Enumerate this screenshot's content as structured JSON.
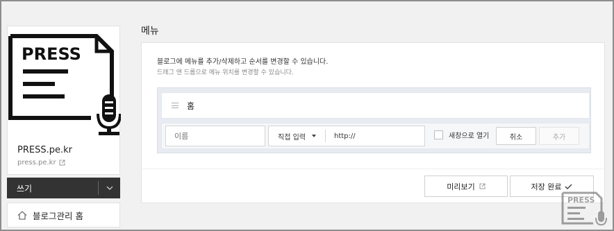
{
  "sidebar": {
    "logo_text": "PRESS",
    "blog_name": "PRESS.pe.kr",
    "blog_url": "press.pe.kr",
    "write_label": "쓰기",
    "admin_home_label": "블로그관리 홈"
  },
  "main": {
    "title": "메뉴",
    "description": "블로그에 메뉴를 추가/삭제하고 순서를 변경할 수 있습니다.",
    "sub_description": "드래그 앤 드롭으로 메뉴 위치를 변경할 수 있습니다.",
    "menu_items": [
      {
        "label": "홈"
      }
    ],
    "editor": {
      "name_placeholder": "이름",
      "type_selected": "직접 입력",
      "url_value": "http://",
      "new_window_label": "새창으로 열기",
      "new_window_checked": false,
      "cancel_label": "취소",
      "add_label": "추가"
    },
    "preview_label": "미리보기",
    "save_label": "저장 완료"
  },
  "watermark": {
    "text": "PRESS"
  }
}
